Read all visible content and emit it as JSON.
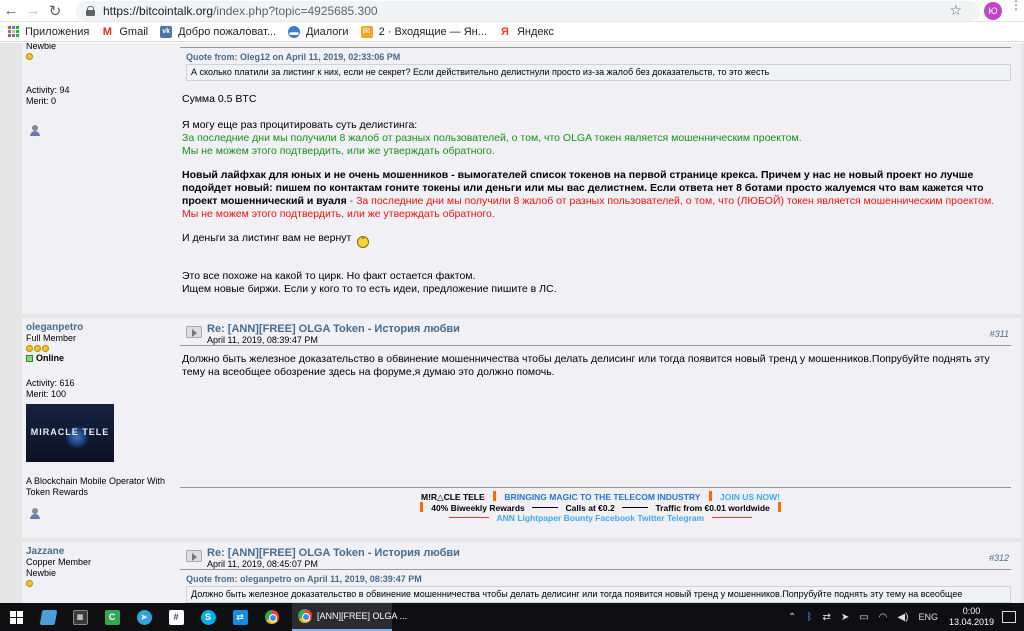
{
  "browser": {
    "url_host": "https://bitcointalk.org",
    "url_path": "/index.php?topic=4925685.300",
    "profile_initials": "Ю"
  },
  "bookmarks": [
    {
      "label": "Приложения",
      "icon": "apps-grid-icon"
    },
    {
      "label": "Gmail",
      "icon": "gmail-icon",
      "color": "#d93025"
    },
    {
      "label": "Добро пожаловат...",
      "icon": "vk-icon",
      "color": "#4a76a8"
    },
    {
      "label": "Диалоги",
      "icon": "chat-icon",
      "color": "#3b7bd4"
    },
    {
      "label": "2 · Входящие — Ян...",
      "icon": "mail-icon",
      "color": "#f5a623"
    },
    {
      "label": "Яндекс",
      "icon": "yandex-icon",
      "color": "#fc3f1d"
    }
  ],
  "post1": {
    "user_rank": "Newbie",
    "activity": "Activity: 94",
    "merit": "Merit: 0",
    "quote_header": "Quote from: Oleg12 on April 11, 2019, 02:33:06 PM",
    "quote_text": "А сколько платили за листинг к них, если не секрет? Если действительно делистнули просто из-за жалоб без доказательств, то это жесть",
    "p1": "Сумма 0.5 BTC",
    "p2": "Я могу еще раз процитировать суть делистинга:",
    "p3_green1": "За последние дни мы получили 8 жалоб от разных пользователей, о том, что OLGA токен является мошенническим проектом.",
    "p3_green2": "Мы не можем этого подтвердить, или же утверждать обратного.",
    "p4_bold": "Новый лайфхак для юных и не очень мошенников - вымогателей список токенов на первой странице крекса. Причем у нас не новый проект но лучше подойдет новый: пишем по контактам гоните токены или деньги или мы вас делистнем. Если ответа нет 8 ботами просто жалуемся что вам кажется что проект мошеннический и вуаля",
    "p4_red_dash": " - ",
    "p4_red1": "За последние дни мы получили 8 жалоб от разных пользователей, о том, что (ЛЮБОЙ) токен является мошенническим проектом.",
    "p4_red2": "Мы не можем этого подтвердить, или же утверждать обратного.",
    "p5": "И деньги за листинг вам не вернут",
    "p6": "Это все похоже на какой то цирк. Но факт остается фактом.",
    "p7": "Ищем новые биржи. Если у кого то то есть идеи, предложение пишите в ЛС."
  },
  "post2": {
    "username": "oleganpetro",
    "user_rank": "Full Member",
    "online": "Online",
    "activity": "Activity: 616",
    "merit": "Merit: 100",
    "avatar_text": "MIRACLE TELE",
    "personal_text": "A Blockchain Mobile Operator With Token Rewards",
    "subject": "Re: [ANN][FREE] OLGA Token - История любви",
    "date": "April 11, 2019, 08:39:47 PM",
    "post_number": "#311",
    "text": "Должно быть железное доказательство в обвинение мошенничества чтобы делать делисинг или тогда появится новый тренд у мошенников.Попрубуйте поднять эту тему на всеобщее обозрение здесь на форуме,я думаю это должно помочь.",
    "sig_brand": "M!R△CLE TELE",
    "sig_tagline": "BRINGING MAGIC TO THE TELECOM INDUSTRY",
    "sig_join": "JOIN US NOW!",
    "sig_rewards": "40% Biweekly Rewards",
    "sig_calls": "Calls at €0.2",
    "sig_traffic": "Traffic from €0.01 worldwide",
    "sig_links": [
      "ANN",
      "Lightpaper",
      "Bounty",
      "Facebook",
      "Twitter",
      "Telegram"
    ]
  },
  "post3": {
    "username": "Jazzane",
    "user_rank": "Copper Member",
    "user_rank2": "Newbie",
    "subject": "Re: [ANN][FREE] OLGA Token - История любви",
    "date": "April 11, 2019, 08:45:07 PM",
    "post_number": "#312",
    "quote_header": "Quote from: oleganpetro on April 11, 2019, 08:39:47 PM",
    "quote_text": "Должно быть железное доказательство в обвинение мошенничества чтобы делать делисинг или тогда появится новый тренд у мошенников.Попрубуйте поднять эту тему на всеобщее"
  },
  "taskbar": {
    "chrome_task_label": "[ANN][FREE] OLGA ...",
    "lang": "ENG",
    "time": "0:00",
    "date": "13.04.2019"
  }
}
